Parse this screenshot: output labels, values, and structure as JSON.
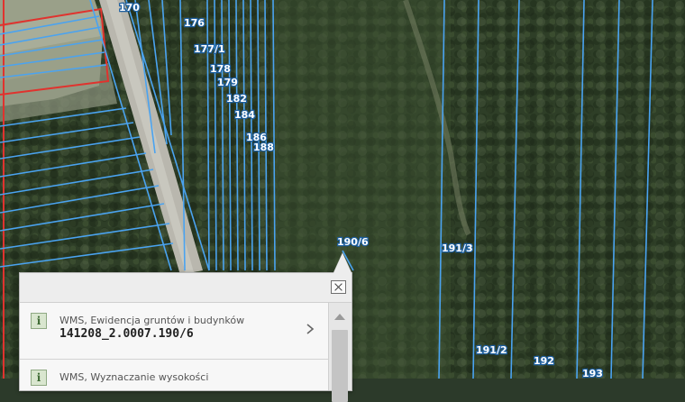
{
  "map": {
    "parcel_labels": [
      "170",
      "176",
      "177/1",
      "178",
      "179",
      "182",
      "184",
      "186",
      "188",
      "190/6",
      "191/3",
      "191/2",
      "192",
      "193"
    ],
    "colors": {
      "parcel_line": "#4aa3f0",
      "parcel_label_fill": "#ffffff",
      "parcel_label_stroke": "#1d5fa0",
      "boundary": "#e0332e",
      "forest_dark": "#26351f",
      "forest_mid": "#3a4c30",
      "field": "#9aa089",
      "road": "#b9b7ae"
    }
  },
  "popup": {
    "close_icon": "close-icon",
    "results": [
      {
        "icon": "info-icon",
        "glyph": "i",
        "title": "WMS, Ewidencja gruntów i budynków",
        "value": "141208_2.0007.190/6"
      },
      {
        "icon": "info-icon",
        "glyph": "i",
        "title": "WMS, Wyznaczanie wysokości",
        "value": ""
      }
    ]
  }
}
